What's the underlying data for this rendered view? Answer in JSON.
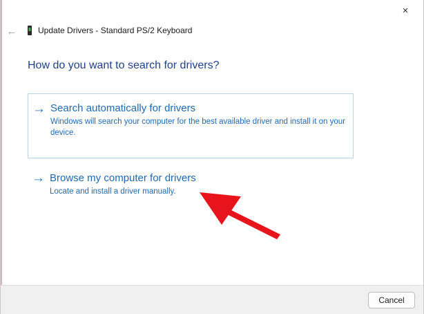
{
  "window": {
    "title": "Update Drivers - Standard PS/2 Keyboard",
    "close_icon": "×",
    "back_icon": "←"
  },
  "main": {
    "heading": "How do you want to search for drivers?",
    "options": [
      {
        "title": "Search automatically for drivers",
        "description": "Windows will search your computer for the best available driver and install it on your device."
      },
      {
        "title": "Browse my computer for drivers",
        "description": "Locate and install a driver manually."
      }
    ],
    "option_arrow": "→"
  },
  "footer": {
    "cancel_label": "Cancel"
  },
  "colors": {
    "link_blue": "#1f69b4",
    "heading_blue": "#1f3f8f",
    "annotation_red": "#e8141b",
    "selection_border": "#b7d3e8"
  }
}
